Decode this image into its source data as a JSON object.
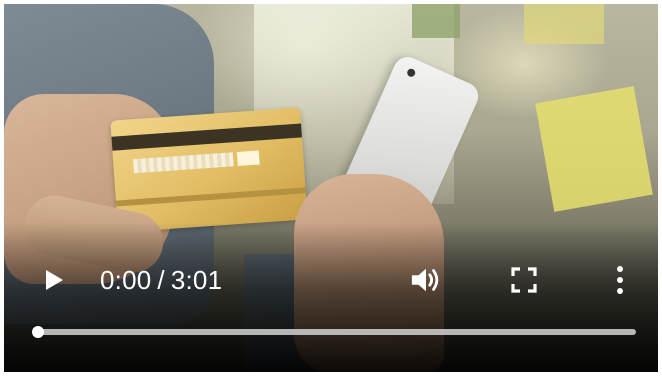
{
  "player": {
    "time": {
      "current": "0:00",
      "separator": "/",
      "duration": "3:01"
    },
    "progress": {
      "played_fraction": 0.0
    },
    "icons": {
      "play": "play-icon",
      "volume": "volume-icon",
      "fullscreen": "fullscreen-icon",
      "more": "more-vertical-icon"
    },
    "colors": {
      "control_foreground": "#ffffff",
      "progress_track": "#d2d2d2"
    }
  }
}
